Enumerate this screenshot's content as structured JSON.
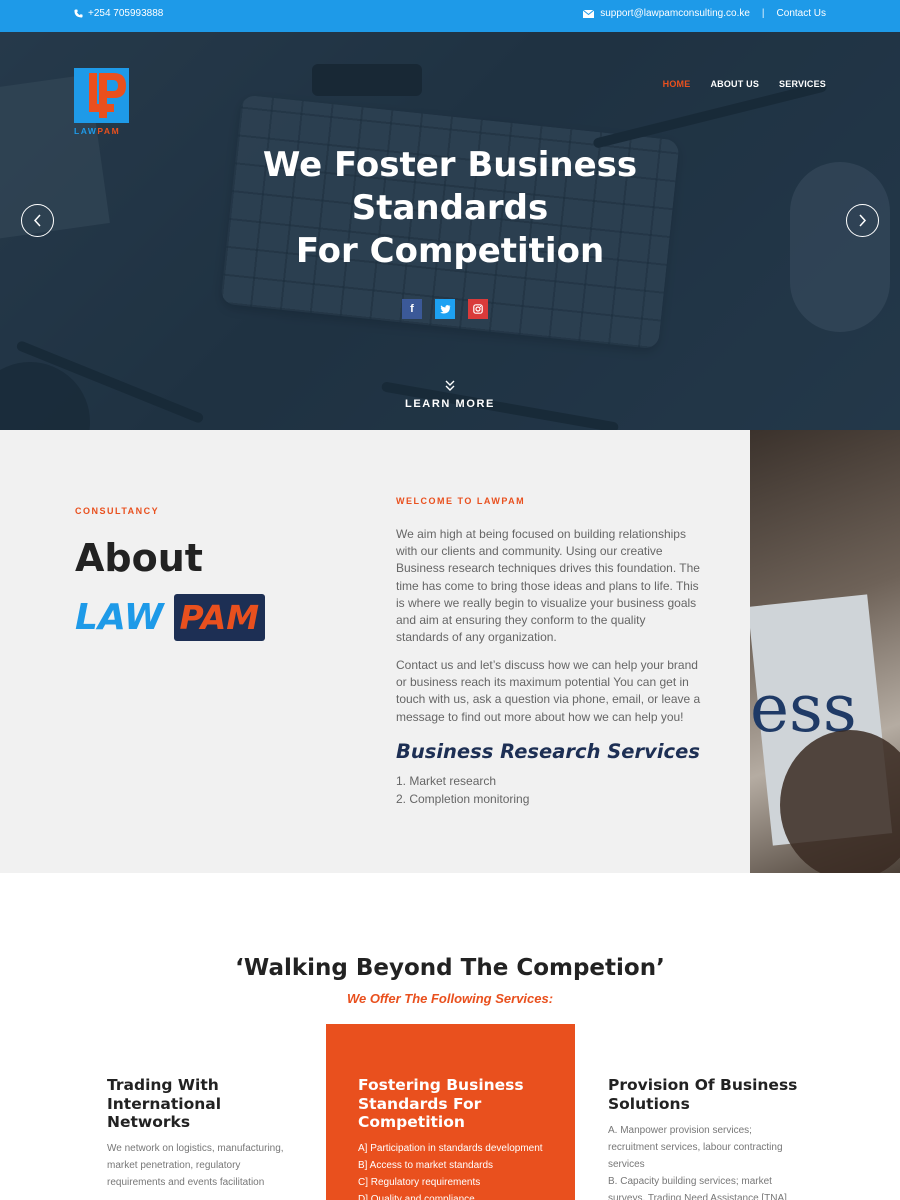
{
  "topbar": {
    "phone": "+254 705993888",
    "email": "support@lawpamconsulting.co.ke",
    "contact_link": "Contact Us",
    "bg_color": "#1e9ae8"
  },
  "logo": {
    "text_a": "LAW",
    "text_b": "PAM"
  },
  "nav": {
    "items": [
      "HOME",
      "ABOUT US",
      "SERVICES"
    ],
    "active": "HOME"
  },
  "hero": {
    "headline": [
      "We Foster Business",
      "Standards",
      "For Competition"
    ],
    "socials": [
      "facebook-icon",
      "twitter-icon",
      "instagram-icon"
    ],
    "learn_more": "LEARN MORE"
  },
  "about": {
    "eyebrow": "CONSULTANCY",
    "title": "About",
    "brand_a": "LAW",
    "brand_b": "PAM",
    "welcome": "WELCOME TO LAWPAM",
    "para1": "We aim high at being focused on building relationships with our clients and community. Using our creative Business research techniques drives this foundation. The time has come to bring those ideas and plans to life. This is where we really begin to visualize your business goals and aim at ensuring they conform to the quality standards of any organization.",
    "para2": "Contact us and let’s discuss how we can help your brand or business reach its maximum potential You can get in touch with us, ask a question via phone, email, or leave a message to find out more about how we can help you!",
    "services_title": "Business Research Services",
    "services": [
      "1. Market research",
      "2. Completion monitoring"
    ]
  },
  "walking": {
    "title": "‘Walking Beyond The Competion’",
    "subtitle": "We Offer The Following Services:",
    "cards": [
      {
        "title": "Trading With International Networks",
        "text": "We network on logistics, manufacturing, market penetration, regulatory requirements and events facilitation"
      },
      {
        "title": "Fostering Business Standards For Competition",
        "items": [
          "A] Participation in standards development",
          "B] Access to market standards",
          "C] Regulatory requirements",
          "D] Quality and compliance"
        ]
      },
      {
        "title": "Provision Of Business Solutions",
        "items": [
          "A. Manpower provision services; recruitment services, labour contracting services",
          "B. Capacity building services; market surveys, Trading Need Assistance [TNA]"
        ]
      }
    ]
  },
  "colors": {
    "accent": "#e9501e",
    "brand_blue": "#1e9ae8",
    "navy": "#1d2f54"
  }
}
